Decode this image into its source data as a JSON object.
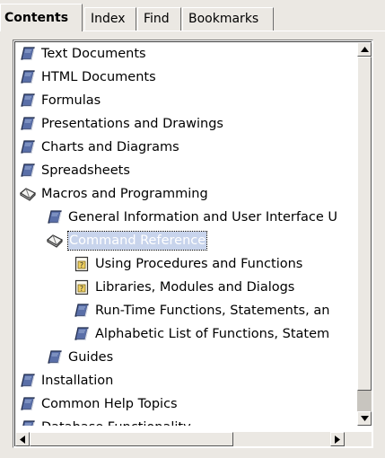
{
  "tabs": [
    {
      "label": "Contents",
      "active": true
    },
    {
      "label": "Index",
      "active": false
    },
    {
      "label": "Find",
      "active": false
    },
    {
      "label": "Bookmarks",
      "active": false
    }
  ],
  "tree": {
    "items": [
      {
        "label": "Text Documents",
        "icon": "closed-book-icon",
        "level": 0
      },
      {
        "label": "HTML Documents",
        "icon": "closed-book-icon",
        "level": 0
      },
      {
        "label": "Formulas",
        "icon": "closed-book-icon",
        "level": 0
      },
      {
        "label": "Presentations and Drawings",
        "icon": "closed-book-icon",
        "level": 0
      },
      {
        "label": "Charts and Diagrams",
        "icon": "closed-book-icon",
        "level": 0
      },
      {
        "label": "Spreadsheets",
        "icon": "closed-book-icon",
        "level": 0
      },
      {
        "label": "Macros and Programming",
        "icon": "open-book-icon",
        "level": 0
      },
      {
        "label": "General Information and User Interface U",
        "icon": "closed-book-icon",
        "level": 1
      },
      {
        "label": "Command Reference",
        "icon": "open-book-icon",
        "level": 1,
        "selected": true
      },
      {
        "label": "Using Procedures and Functions",
        "icon": "help-page-icon",
        "level": 2
      },
      {
        "label": "Libraries, Modules and Dialogs",
        "icon": "help-page-icon",
        "level": 2
      },
      {
        "label": "Run-Time Functions, Statements, an",
        "icon": "closed-book-icon",
        "level": 2
      },
      {
        "label": "Alphabetic List of Functions, Statem",
        "icon": "closed-book-icon",
        "level": 2
      },
      {
        "label": "Guides",
        "icon": "closed-book-icon",
        "level": 1
      },
      {
        "label": "Installation",
        "icon": "closed-book-icon",
        "level": 0
      },
      {
        "label": "Common Help Topics",
        "icon": "closed-book-icon",
        "level": 0
      },
      {
        "label": "Database Functionality",
        "icon": "closed-book-icon",
        "level": 0
      }
    ]
  },
  "scrollbars": {
    "vertical_position": 0.86,
    "horizontal_position": 0.0
  },
  "colors": {
    "background": "#ebe8e3",
    "selection": "#c8d4ec",
    "book_blue": "#5a6fa8"
  }
}
